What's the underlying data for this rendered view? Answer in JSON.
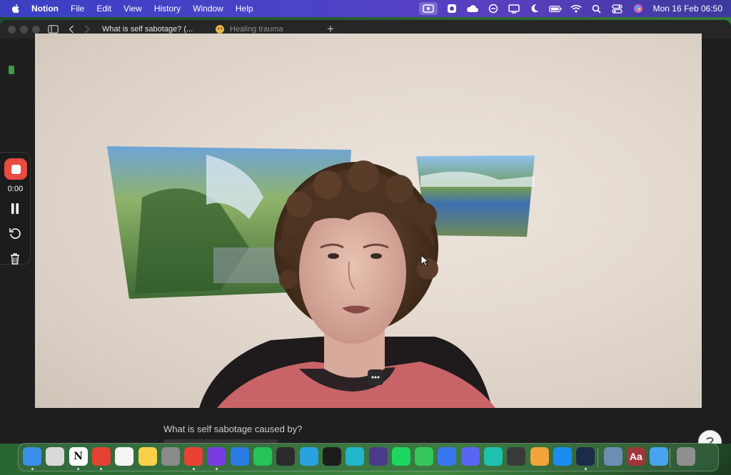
{
  "menubar": {
    "app_name": "Notion",
    "menus": [
      "File",
      "Edit",
      "View",
      "History",
      "Window",
      "Help"
    ],
    "clock": "Mon 16 Feb  06:50",
    "status_icons": [
      "screen-recording-icon",
      "app-icon",
      "cloud-icon",
      "circle-icon",
      "display-icon",
      "moon-icon",
      "battery-icon",
      "wifi-icon",
      "search-icon",
      "control-center-icon",
      "siri-icon"
    ]
  },
  "tabs": [
    {
      "label": "What is self sabotage? (..."
    },
    {
      "label": "Healing trauma"
    }
  ],
  "page": {
    "visible_text": "What is self sabotage caused by?"
  },
  "recorder": {
    "time": "0:00",
    "stop_color": "#ea4a3f"
  },
  "dock": {
    "apps": [
      {
        "name": "finder-icon",
        "color": "#3b8ee8",
        "glyph": ""
      },
      {
        "name": "launchpad-icon",
        "color": "#d9d9d9",
        "glyph": ""
      },
      {
        "name": "notion-icon",
        "color": "#ffffff",
        "glyph": "N"
      },
      {
        "name": "todoist-icon",
        "color": "#e44232",
        "glyph": ""
      },
      {
        "name": "reminders-icon",
        "color": "#f5f5f5",
        "glyph": ""
      },
      {
        "name": "notes-icon",
        "color": "#f7d14a",
        "glyph": ""
      },
      {
        "name": "system-settings-icon",
        "color": "#8a8a8a",
        "glyph": ""
      },
      {
        "name": "chrome-icon",
        "color": "#e94235",
        "glyph": ""
      },
      {
        "name": "arc-icon",
        "color": "#7a3be0",
        "glyph": ""
      },
      {
        "name": "app-store-gear-icon",
        "color": "#2a7be4",
        "glyph": ""
      },
      {
        "name": "whatsapp-icon",
        "color": "#27c25a",
        "glyph": ""
      },
      {
        "name": "voice-memos-icon",
        "color": "#2b2b2b",
        "glyph": ""
      },
      {
        "name": "telegram-icon",
        "color": "#2aa2e0",
        "glyph": ""
      },
      {
        "name": "capcut-icon",
        "color": "#1c1c1c",
        "glyph": ""
      },
      {
        "name": "canva-icon",
        "color": "#21b6c9",
        "glyph": ""
      },
      {
        "name": "proton-vpn-icon",
        "color": "#4a3a8c",
        "glyph": ""
      },
      {
        "name": "spotify-icon",
        "color": "#1ed760",
        "glyph": ""
      },
      {
        "name": "messages-icon",
        "color": "#34c759",
        "glyph": ""
      },
      {
        "name": "signal-icon",
        "color": "#3a76f0",
        "glyph": ""
      },
      {
        "name": "discord-icon",
        "color": "#5865f2",
        "glyph": ""
      },
      {
        "name": "surfshark-icon",
        "color": "#1fc1b0",
        "glyph": ""
      },
      {
        "name": "photo-app-icon",
        "color": "#3a3a3a",
        "glyph": ""
      },
      {
        "name": "photos-icon",
        "color": "#f2a33a",
        "glyph": ""
      },
      {
        "name": "app-store-icon",
        "color": "#1c8df0",
        "glyph": ""
      },
      {
        "name": "fluent-icon",
        "color": "#1d2b4a",
        "glyph": ""
      },
      {
        "name": "preview-icon",
        "color": "#6b8fb4",
        "glyph": ""
      },
      {
        "name": "dictionary-icon",
        "color": "#a0353a",
        "glyph": "Aa"
      },
      {
        "name": "mail-icon",
        "color": "#4aa3f0",
        "glyph": ""
      },
      {
        "name": "trash-icon",
        "color": "#8f8f8f",
        "glyph": ""
      }
    ]
  }
}
